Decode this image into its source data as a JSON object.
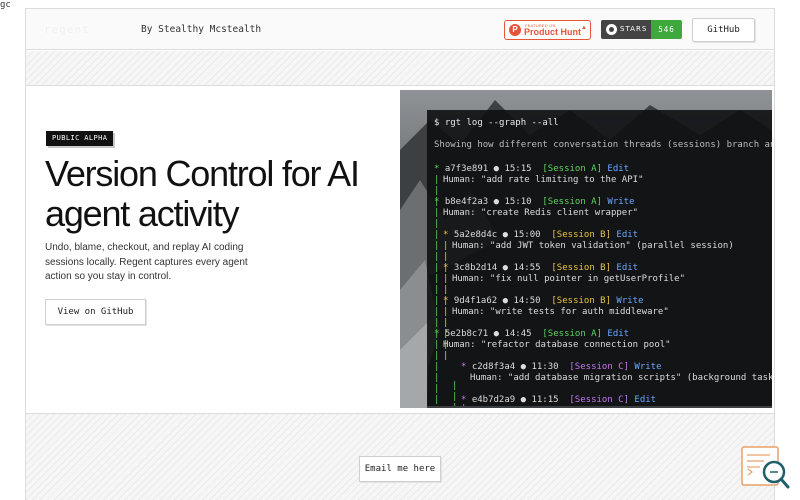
{
  "corner_tag": "gc",
  "header": {
    "byline": "By Stealthy Mcstealth",
    "product_hunt": {
      "small": "FEATURED ON",
      "label": "Product Hunt",
      "accent": "#e6553a"
    },
    "stars_badge": {
      "label": "STARS",
      "count": "546",
      "count_color": "#3fa83d"
    },
    "github_button": "GitHub"
  },
  "hero": {
    "badge": "PUBLIC ALPHA",
    "title": "Version Control for AI agent activity",
    "description": "Undo, blame, checkout, and replay AI coding sessions locally. Regent captures every agent action so you stay in control.",
    "cta": "View on GitHub"
  },
  "terminal": {
    "command": "$ rgt log --graph --all",
    "intro": "Showing how different conversation threads (sessions) branch and",
    "entries": [
      {
        "hash": "a7f3e891",
        "time": "15:15",
        "session": "[Session A]",
        "action": "Edit",
        "message": "Human: \"add rate limiting to the API\""
      },
      {
        "hash": "b8e4f2a3",
        "time": "15:10",
        "session": "[Session A]",
        "action": "Write",
        "message": "Human: \"create Redis client wrapper\""
      },
      {
        "hash": "5a2e8d4c",
        "time": "15:00",
        "session": "[Session B]",
        "action": "Edit",
        "message": "Human: \"add JWT token validation\" (parallel session)"
      },
      {
        "hash": "3c8b2d14",
        "time": "14:55",
        "session": "[Session B]",
        "action": "Edit",
        "message": "Human: \"fix null pointer in getUserProfile\""
      },
      {
        "hash": "9d4f1a62",
        "time": "14:50",
        "session": "[Session B]",
        "action": "Write",
        "message": "Human: \"write tests for auth middleware\""
      },
      {
        "hash": "5e2b8c71",
        "time": "14:45",
        "session": "[Session A]",
        "action": "Edit",
        "message": "Human: \"refactor database connection pool\""
      },
      {
        "hash": "c2d8f3a4",
        "time": "11:30",
        "session": "[Session C]",
        "action": "Write",
        "message": "Human: \"add database migration scripts\" (background task)"
      },
      {
        "hash": "e4b7d2a9",
        "time": "11:15",
        "session": "[Session C]",
        "action": "Edit",
        "message": ""
      }
    ]
  },
  "footer": {
    "email_button": "Email me here"
  },
  "corner_widget": {
    "icon": "search-code-icon"
  }
}
